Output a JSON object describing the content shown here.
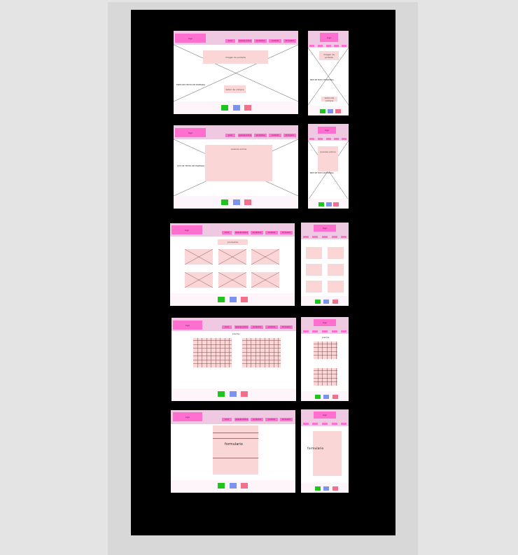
{
  "colors": {
    "board": "#000000",
    "header": "#efc9e1",
    "logo_nav": "#ff6fcf",
    "content_block": "#fbd6d6",
    "footer_green": "#1fc41f",
    "footer_blue": "#7b93ee",
    "footer_pink": "#f27089"
  },
  "icons": [
    "image-placeholder-icon",
    "footer-social-icon"
  ],
  "nav_items": [
    "inicio",
    "quienes somos",
    "productos",
    "contacto",
    "formulario"
  ],
  "row1": {
    "desktop": {
      "logo": "logo",
      "block_top": "imagen de portada",
      "banner_text": "ENTE DE TEXTO DE PORTADA",
      "block_bottom": "boton de compra"
    },
    "mobile": {
      "logo": "logo",
      "block_top": "imagen de portada",
      "banner_text": "ENTE DE TEXTO DE PORTADA",
      "block_bottom": "boton de compra"
    }
  },
  "row2": {
    "desktop": {
      "logo": "logo",
      "block": "quienes somos",
      "banner_text": "CTE DE TEXTO DE PORTADA"
    },
    "mobile": {
      "logo": "logo",
      "block": "quienes somos",
      "banner_text": "ENTE DE TEXTO DE PORTADA"
    }
  },
  "row3": {
    "desktop": {
      "logo": "logo",
      "section_title": "productos"
    },
    "mobile": {
      "logo": "logo"
    }
  },
  "row4": {
    "desktop": {
      "logo": "logo",
      "section_title": "precios"
    },
    "mobile": {
      "logo": "logo",
      "section_title": "precios"
    }
  },
  "row5": {
    "desktop": {
      "logo": "logo",
      "form_label": "formulario"
    },
    "mobile": {
      "logo": "logo",
      "form_label": "formulario"
    }
  }
}
